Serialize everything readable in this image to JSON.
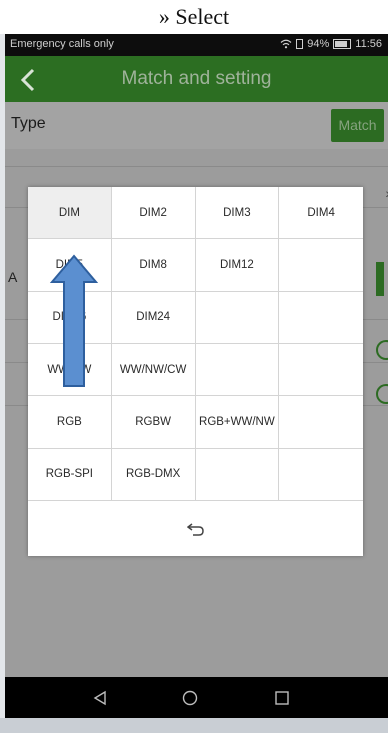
{
  "caption": "» Select",
  "status_bar": {
    "carrier": "Emergency calls only",
    "battery": "94%",
    "time": "11:56"
  },
  "app_bar": {
    "title": "Match and setting"
  },
  "type_row": {
    "label": "Type",
    "match_label": "Match"
  },
  "background": {
    "row_letter": "A"
  },
  "dialog": {
    "options": [
      "DIM",
      "DIM2",
      "DIM3",
      "DIM4",
      "DIM5",
      "DIM8",
      "DIM12",
      "",
      "DIM16",
      "DIM24",
      "",
      "",
      "WW/NW",
      "WW/NW/CW",
      "",
      "",
      "RGB",
      "RGBW",
      "RGB+WW/NW",
      "",
      "RGB-SPI",
      "RGB-DMX",
      "",
      ""
    ],
    "selected": "DIM",
    "back_icon": "undo-arrow-icon"
  },
  "annotation": {
    "arrow_icon": "up-arrow-icon",
    "color": "#5b8fd0"
  },
  "colors": {
    "app_bar": "#2c6e22",
    "status_bar": "#0d0d0d",
    "nav_bar": "#000000"
  }
}
